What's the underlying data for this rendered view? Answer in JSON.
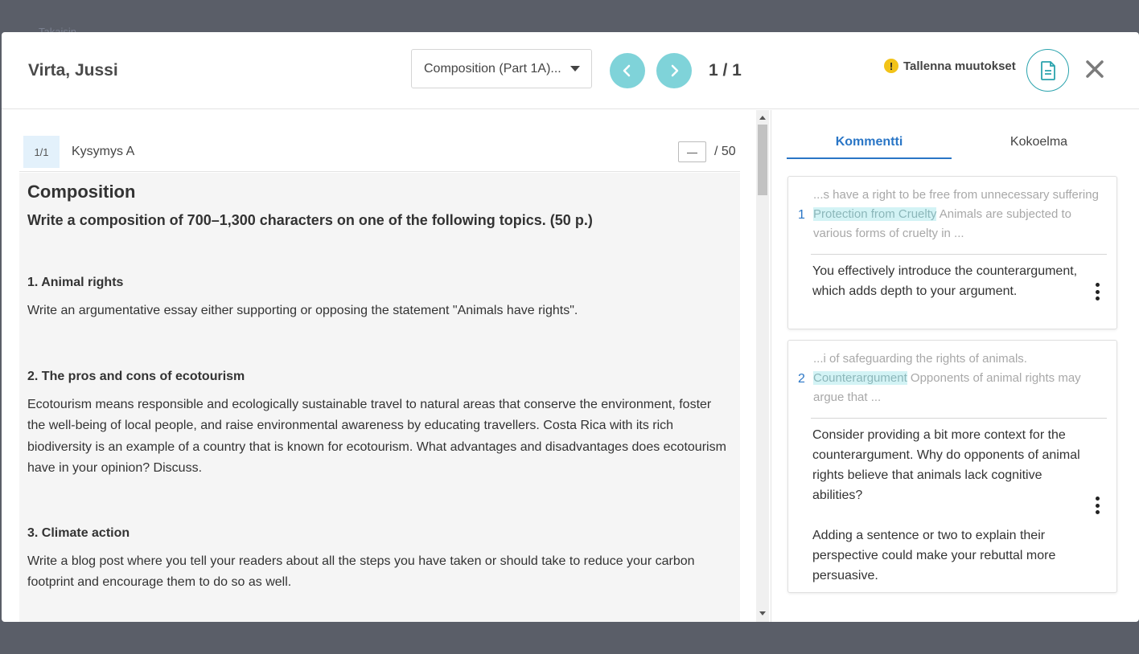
{
  "background": {
    "peek_text": "Takaisin"
  },
  "header": {
    "student_name": "Virta, Jussi",
    "assignment_select": "Composition (Part 1A)...",
    "counter": "1 / 1",
    "save_label": "Tallenna muutokset",
    "warning_symbol": "!"
  },
  "question": {
    "number": "1/1",
    "label": "Kysymys A",
    "score_value": "—",
    "max_score": "/ 50"
  },
  "content": {
    "title": "Composition",
    "subtitle": "Write a composition of 700–1,300 characters on one of the following topics. (50 p.)",
    "topics": [
      {
        "heading": "1. Animal rights",
        "body": "Write an argumentative essay either supporting or opposing the statement \"Animals have rights\"."
      },
      {
        "heading": "2. The pros and cons of ecotourism",
        "body": "Ecotourism means responsible and ecologically sustainable travel to natural areas that conserve the environment, foster the well-being of local people, and raise environmental awareness by educating travellers. Costa Rica with its rich biodiversity is an example of a country that is known for ecotourism. What advantages and disadvantages does ecotourism have in your opinion? Discuss."
      },
      {
        "heading": "3. Climate action",
        "body": "Write a blog post where you tell your readers about all the steps you have taken or should take to reduce your carbon footprint and encourage them to do so as well."
      }
    ]
  },
  "tabs": {
    "comment": "Kommentti",
    "collection": "Kokoelma"
  },
  "comments": [
    {
      "number": "1",
      "quote_before": "...s have a right to be free from unnecessary suffering ",
      "quote_highlight": "Protection from Cruelty",
      "quote_after": " Animals are subjected to various forms of cruelty in ...",
      "text": "You effectively introduce the counterargument, which adds depth to your argument."
    },
    {
      "number": "2",
      "quote_before": "...i of safeguarding the rights of animals. ",
      "quote_highlight": "Counterargument",
      "quote_after": " Opponents of animal rights may argue that ...",
      "text": "Consider providing a bit more context for the counterargument. Why do opponents of animal rights believe that animals lack cognitive abilities?",
      "text2": "Adding a sentence or two to explain their perspective could make your rebuttal more persuasive."
    }
  ],
  "colors": {
    "accent": "#2a76c6",
    "nav_button": "#7fd3d9",
    "highlight": "#d3f3f5",
    "warning": "#f2c318"
  }
}
